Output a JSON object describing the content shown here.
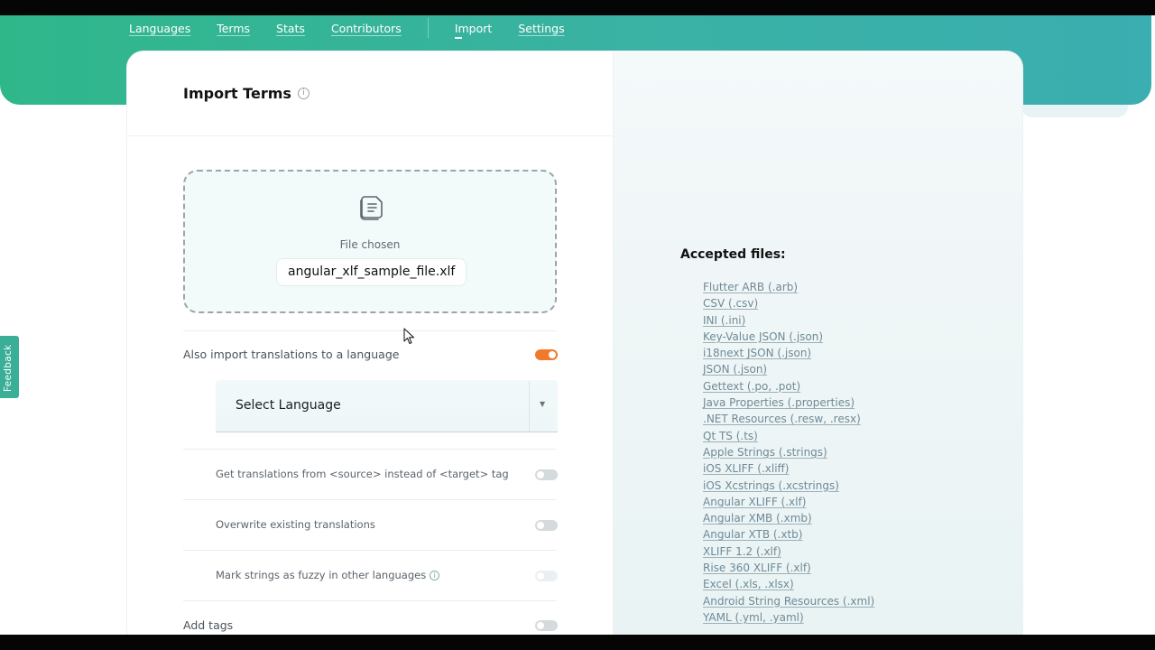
{
  "nav": {
    "items": [
      {
        "label": "Languages",
        "active": false
      },
      {
        "label": "Terms",
        "active": false
      },
      {
        "label": "Stats",
        "active": false
      },
      {
        "label": "Contributors",
        "active": false
      },
      {
        "label": "Import",
        "active": true
      },
      {
        "label": "Settings",
        "active": false
      }
    ]
  },
  "import": {
    "title": "Import Terms",
    "info_icon": "info-icon",
    "dropzone": {
      "icon": "file-upload-icon",
      "status": "File chosen",
      "file_name": "angular_xlf_sample_file.xlf"
    },
    "also_import": {
      "label": "Also import translations to a language",
      "enabled": true
    },
    "select_language": {
      "label": "Select Language",
      "icon": "caret-down-icon"
    },
    "options": [
      {
        "label": "Get translations from <source> instead of <target> tag",
        "enabled": false
      },
      {
        "label": "Overwrite existing translations",
        "enabled": false
      },
      {
        "label": "Mark strings as fuzzy in other languages",
        "enabled": false,
        "disabled": true
      }
    ],
    "add_tags": {
      "label": "Add tags",
      "enabled": false
    }
  },
  "accepted": {
    "title": "Accepted files:",
    "files": [
      "Flutter ARB (.arb)",
      "CSV (.csv)",
      "INI (.ini)",
      "Key-Value JSON (.json)",
      "i18next JSON (.json)",
      "JSON (.json)",
      "Gettext (.po, .pot)",
      "Java Properties (.properties)",
      ".NET Resources (.resw, .resx)",
      "Qt TS (.ts)",
      "Apple Strings (.strings)",
      "iOS XLIFF (.xliff)",
      "iOS Xcstrings (.xcstrings)",
      "Angular XLIFF (.xlf)",
      "Angular XMB (.xmb)",
      "Angular XTB (.xtb)",
      "XLIFF 1.2 (.xlf)",
      "Rise 360 XLIFF (.xlf)",
      "Excel (.xls, .xlsx)",
      "Android String Resources (.xml)",
      "YAML (.yml, .yaml)"
    ]
  },
  "feedback": {
    "label": "Feedback"
  },
  "colors": {
    "brand": "#3ab2a4",
    "toggle_on": "#f07a2a"
  }
}
